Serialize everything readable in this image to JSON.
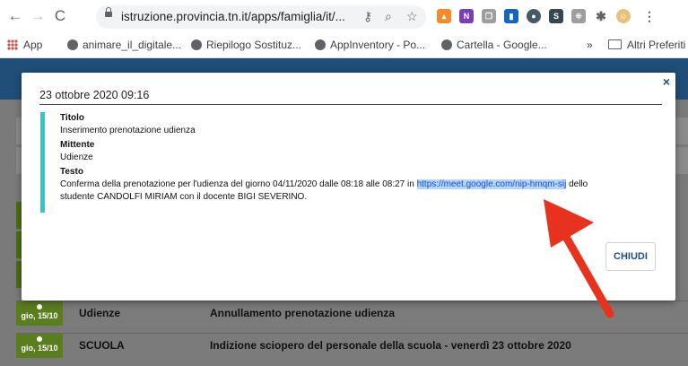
{
  "browser": {
    "url": "istruzione.provincia.tn.it/apps/famiglia/it/...",
    "bookmarks": [
      "App",
      "animare_il_digitale...",
      "Riepilogo Sostituz...",
      "AppInventory - Po...",
      "Cartella - Google..."
    ],
    "overflow": "»",
    "other_bookmarks": "Altri Preferiti"
  },
  "modal": {
    "date": "23 ottobre 2020 09:16",
    "fields": [
      {
        "label": "Titolo",
        "value": "Inserimento prenotazione udienza"
      },
      {
        "label": "Mittente",
        "value": "Udienze"
      },
      {
        "label": "Testo",
        "value_before": "Conferma della prenotazione per l'udienza del giorno 04/11/2020 dalle 08:18 alle 08:27 in ",
        "link": "https://meet.google.com/nip-hmqm-sij",
        "value_after": " dello",
        "value_line2": "studente CANDOLFI MIRIAM con il docente BIGI SEVERINO."
      }
    ],
    "close_button": "CHIUDI",
    "close_icon": "×"
  },
  "list": [
    {
      "date": "gio, 15/10",
      "sender": "Udienze",
      "subject": "Annullamento prenotazione udienza"
    },
    {
      "date": "gio, 15/10",
      "sender": "SCUOLA",
      "subject": "Indizione sciopero del personale della scuola - venerdì 23 ottobre 2020"
    }
  ],
  "colors": {
    "accent_bar": "#36c5c9",
    "annotation_arrow": "#e8321e",
    "header": "#1f4e79"
  }
}
